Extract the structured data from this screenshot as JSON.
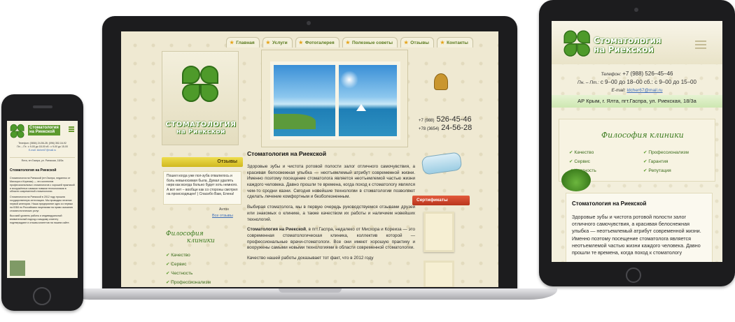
{
  "laptop": {
    "nav": [
      {
        "label": "Главная"
      },
      {
        "label": "Услуги"
      },
      {
        "label": "Фотогалерея"
      },
      {
        "label": "Полезные советы"
      },
      {
        "label": "Отзывы"
      },
      {
        "label": "Контакты"
      }
    ],
    "logo_text_line1": "СТОМАТОЛОГИЯ",
    "logo_text_line2": "на Риекской",
    "phones": [
      {
        "code": "+7 (988)",
        "number": "526-45-46"
      },
      {
        "code": "+78 (3654)",
        "number": "24-56-28"
      }
    ],
    "reviews_title": "Отзывы",
    "review_text": "Пошел когда уже пол-зуба отвалилось и боль невыносимая была. Думал удалять нерв как всегда больно будет хоть немного. А вот нет – вообще как со стороны смотрел на происходящее! ) Спасибо Вам, Елена!",
    "review_author": "Антон",
    "review_all_link": "Все отзывы",
    "philosophy_title_line1": "Философия",
    "philosophy_title_line2": "клиники",
    "philosophy_items": [
      "Качество",
      "Сервис",
      "Честность",
      "Профессионализм"
    ],
    "main_title": "Стоматология на Риекской",
    "paragraph1": "Здоровые зубы и чистота ротовой полости залог отличного самочувствия, а красивая белоснежная улыбка — неотъемлемый атрибут современной жизни. Именно поэтому посещение стоматолога является неотъемлемой частью жизни каждого человека. Давно прошли те времена, когда поход к стоматологу являлся чем-то сродни казни. Сегодня новейшие технологии в стоматологии позволяют сделать лечение комфортным и безболезненным.",
    "paragraph2": "Выбирая стоматолога, мы в первую очередь руководствуемся отзывами друзей или знакомых о клинике, а также качеством их работы и наличием новейших технологий.",
    "paragraph3_bold": "Стоматология на Риекской",
    "paragraph3_rest": ", в пгт.Гаспра, недалеко от Мисхора и Кореиза — это современная стоматологическая клиника, коллектив которой — профессиональные врачи-стоматологи. Все они имеют хорошую практику и вооружены самыми новыми технологиями в области современной стоматологии.",
    "paragraph4": "Качество нашей работы доказывает тот факт, что в 2012 году",
    "certificates_title": "Сертификаты"
  },
  "phone": {
    "logo_text_line1": "Стоматология",
    "logo_text_line2": "на Риекской",
    "contacts_line1": "Телефон: (0654) 24-56-28; (096) 352-16-92",
    "contacts_line2": "Пн. – Пт.: с 9-00 до 18-00 сб.: с 9-00 до 15-00",
    "contacts_line3": "E-mail: ldcher67@mail.ru",
    "address": "Ялта, пгт.Гаспра, ул. Риекская, 18/3а",
    "title": "Стоматология на Риекской",
    "p1": "Стоматология на Риекской (пгт.Гаспра, недалеко от Мисхора и Кореиза) — это коллектив профессиональных стоматологов с хорошей практикой и вооружённых самыми новыми технологиями в области современной стоматологии.",
    "p2": "Стоматология на Риекской в 2012 году прошла государственную аттестацию. Мы проводим лечение первой категории. Наша предприятие одно из первых на ЮБК по Российским лицензиям на право оказания стоматологических услуг.",
    "p3": "Высокий уровень работы и индивидуальный внимательный подход к каждому клиенту подтверждают и отзывы клиентов на нашем сайте."
  },
  "tablet": {
    "logo_text_line1": "Стоматология",
    "logo_text_line2": "на Риекской",
    "phone_label": "Телефон:",
    "phone_value": "+7 (988) 526–45–46",
    "hours_label": "Пн. – Пт.:",
    "hours_value": "с 9–00 до 18–00 сб.: с 9–00 до 15–00",
    "email_label": "E-mail:",
    "email_value": "ldcher67@mail.ru",
    "address": "АР Крым, г. Ялта, пгт.Гаспра, ул. Риекская, 18/3а",
    "philosophy_title": "Философия клиники",
    "philosophy_left": [
      "Качество",
      "Сервис",
      "Честность"
    ],
    "philosophy_right": [
      "Профессионализм",
      "Гарантия",
      "Репутация"
    ],
    "title": "Стоматология на Риекской",
    "paragraph": "Здоровые зубы и чистота ротовой полости залог отличного самочувствия, а красивая белоснежная улыбка — неотъемлемый атрибут современной жизни. Именно поэтому посещение стоматолога является неотъемлемой частью жизни каждого человека. Давно прошли те времена, когда поход к стоматологу"
  }
}
